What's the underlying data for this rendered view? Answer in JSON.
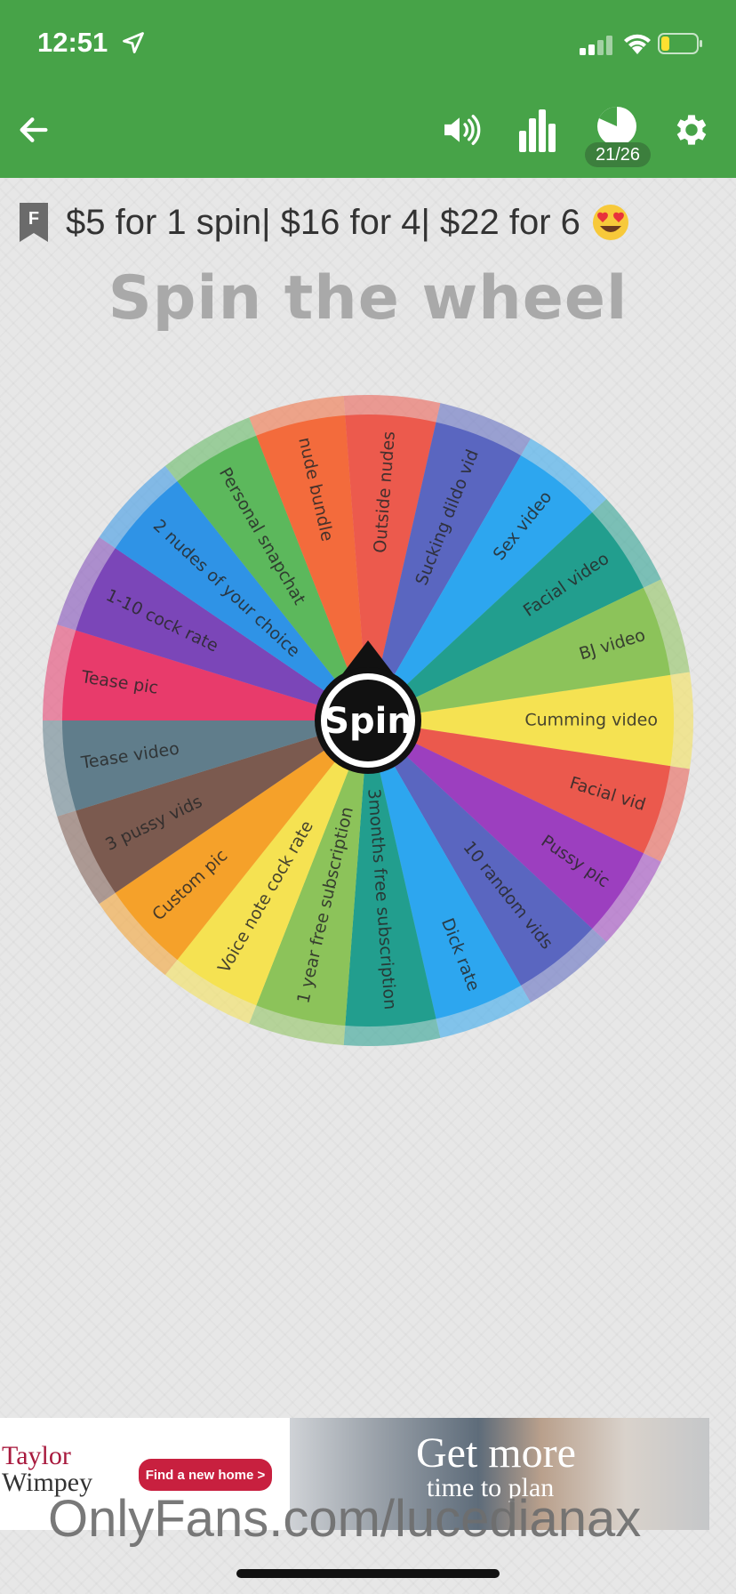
{
  "status_bar": {
    "time": "12:51"
  },
  "toolbar": {
    "counter": "21/26"
  },
  "description": {
    "text": "$5 for 1 spin| $16 for 4| $22 for 6"
  },
  "wheel": {
    "title": "Spin the wheel",
    "spin_label": "Spin",
    "segments": [
      {
        "label": "Cumming video",
        "color": "#f5e252"
      },
      {
        "label": "Facial vid",
        "color": "#eb594d"
      },
      {
        "label": "Pussy pic",
        "color": "#9c3fbf"
      },
      {
        "label": "10 random vids",
        "color": "#5a66c0"
      },
      {
        "label": "Dick rate",
        "color": "#2da6ef"
      },
      {
        "label": "3months free subscription",
        "color": "#229e8e"
      },
      {
        "label": "1 year free subscription",
        "color": "#8cc35a"
      },
      {
        "label": "Voice note cock rate",
        "color": "#f5e252"
      },
      {
        "label": "Custom pic",
        "color": "#f5a12a"
      },
      {
        "label": "3 pussy vids",
        "color": "#7b5a4f"
      },
      {
        "label": "Tease video",
        "color": "#607d8b"
      },
      {
        "label": "Tease pic",
        "color": "#e83b6b"
      },
      {
        "label": "1-10 cock rate",
        "color": "#7b46b8"
      },
      {
        "label": "2 nudes of your choice",
        "color": "#2f93e6"
      },
      {
        "label": "Personal snapchat",
        "color": "#5cb85c"
      },
      {
        "label": "nude bundle",
        "color": "#f36b3c"
      },
      {
        "label": "Outside nudes",
        "color": "#ec5a4d"
      },
      {
        "label": "Sucking dildo vid",
        "color": "#5a66c0"
      },
      {
        "label": "Sex video",
        "color": "#2da6ef"
      },
      {
        "label": "Facial video",
        "color": "#229e8e"
      },
      {
        "label": "BJ video",
        "color": "#8cc35a"
      }
    ]
  },
  "ad": {
    "brand_line1": "Taylor",
    "brand_line2": "Wimpey",
    "cta": "Find a new home >",
    "headline": "Get more",
    "subline": "time to plan"
  },
  "watermark": "OnlyFans.com/lucedianax",
  "colors": {
    "header_green": "#47a348",
    "title_grey": "#a9a9a9"
  }
}
